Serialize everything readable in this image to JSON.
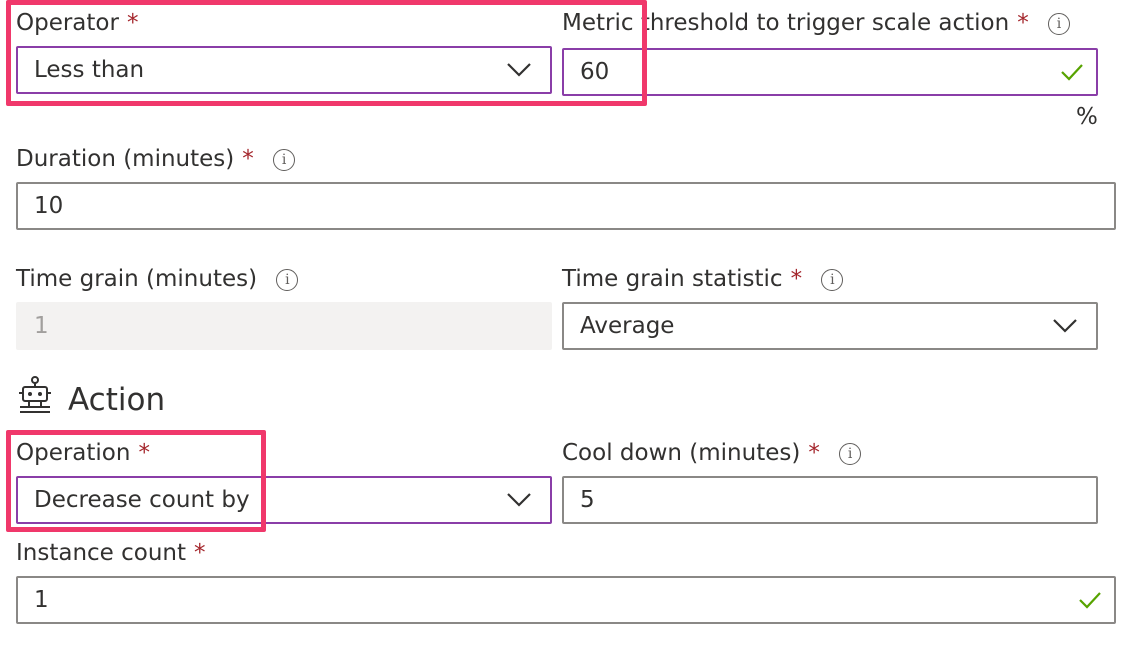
{
  "operator": {
    "label": "Operator",
    "required_mark": "*",
    "value": "Less than"
  },
  "metric_threshold": {
    "label": "Metric threshold to trigger scale action",
    "required_mark": "*",
    "value": "60",
    "unit": "%"
  },
  "duration": {
    "label": "Duration (minutes)",
    "required_mark": "*",
    "value": "10"
  },
  "time_grain": {
    "label": "Time grain (minutes)",
    "value": "1"
  },
  "time_grain_statistic": {
    "label": "Time grain statistic",
    "required_mark": "*",
    "value": "Average"
  },
  "action_section": {
    "title": "Action",
    "icon": "robot-icon"
  },
  "operation": {
    "label": "Operation",
    "required_mark": "*",
    "value": "Decrease count by"
  },
  "cool_down": {
    "label": "Cool down (minutes)",
    "required_mark": "*",
    "value": "5"
  },
  "instance_count": {
    "label": "Instance count",
    "required_mark": "*",
    "value": "1"
  },
  "info_glyph": "i",
  "colors": {
    "required": "#a4262c",
    "focus_border": "#8a3ea8",
    "highlight": "#f0386b",
    "valid_check": "#57a300"
  }
}
